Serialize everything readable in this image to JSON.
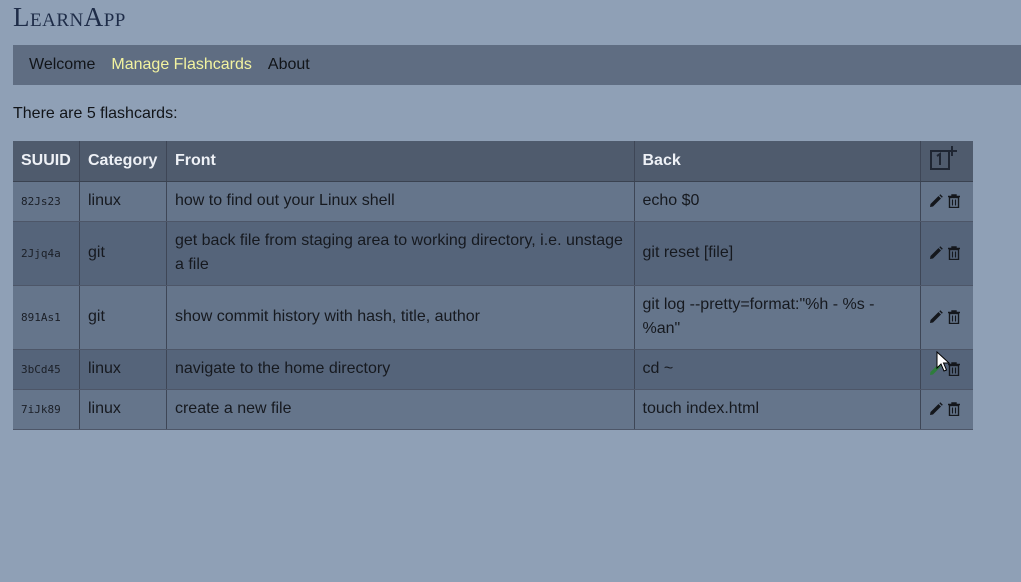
{
  "app": {
    "title": "LearnApp"
  },
  "nav": {
    "items": [
      {
        "label": "Welcome",
        "active": false
      },
      {
        "label": "Manage Flashcards",
        "active": true
      },
      {
        "label": "About",
        "active": false
      }
    ]
  },
  "main": {
    "count_text": "There are 5 flashcards:"
  },
  "table": {
    "headers": {
      "suuid": "SUUID",
      "category": "Category",
      "front": "Front",
      "back": "Back",
      "add_icon": "add-card-icon"
    },
    "rows": [
      {
        "suuid": "82Js23",
        "category": "linux",
        "front": "how to find out your Linux shell",
        "back": "echo $0"
      },
      {
        "suuid": "2Jjq4a",
        "category": "git",
        "front": "get back file from staging area to working directory, i.e. unstage a file",
        "back": "git reset [file]"
      },
      {
        "suuid": "891As1",
        "category": "git",
        "front": "show commit history with hash, title, author",
        "back": "git log --pretty=format:\"%h - %s - %an\""
      },
      {
        "suuid": "3bCd45",
        "category": "linux",
        "front": "navigate to the home directory",
        "back": "cd ~"
      },
      {
        "suuid": "7iJk89",
        "category": "linux",
        "front": "create a new file",
        "back": "touch index.html"
      }
    ],
    "row_icons": [
      "pencil-icon",
      "trash-icon"
    ]
  },
  "colors": {
    "background": "#8fa0b6",
    "navbar": "#5f6d82",
    "nav_active": "#f3f3a0",
    "title": "#1e2c48",
    "table_header": "#4f5b6d",
    "row": "#65758b",
    "row_alt": "#55647a"
  }
}
